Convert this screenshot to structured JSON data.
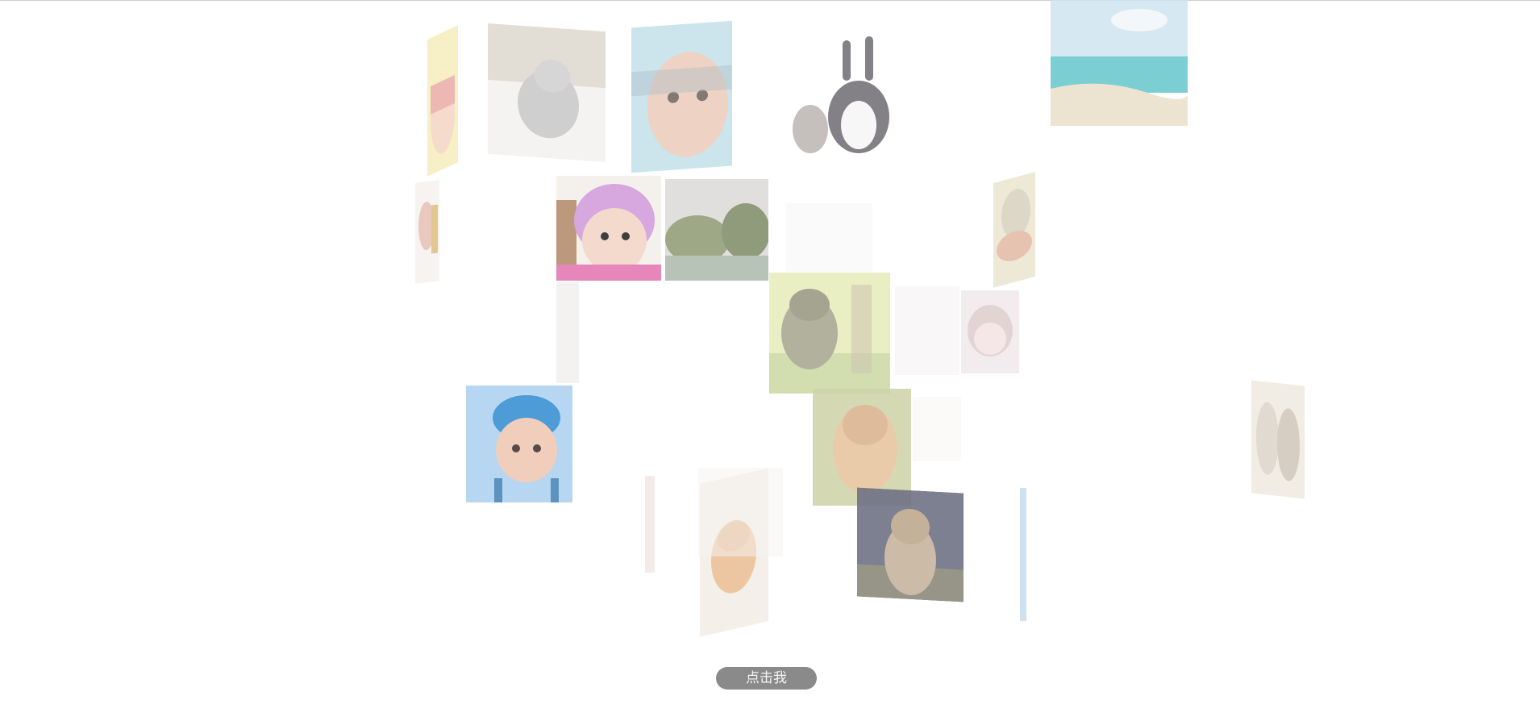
{
  "button": {
    "label": "点击我"
  },
  "gallery": {
    "tiles": [
      {
        "subject": "baby-hat",
        "palette": [
          "#f6ecb8",
          "#e9a7a0",
          "#f3d3bf"
        ]
      },
      {
        "subject": "kitten-grey",
        "palette": [
          "#d9d2c8",
          "#bfbfbf",
          "#f1efee"
        ]
      },
      {
        "subject": "baby-face",
        "palette": [
          "#bcdbe6",
          "#e9c4b0",
          "#8fa4b3"
        ]
      },
      {
        "subject": "cat-and-rabbit",
        "palette": [
          "#ffffff",
          "#6e6a72",
          "#bdb6b1"
        ]
      },
      {
        "subject": "beach",
        "palette": [
          "#cfe4f0",
          "#65c7cc",
          "#eadfc9"
        ]
      },
      {
        "subject": "baby-small",
        "palette": [
          "#f5f0ec",
          "#e2b7a7",
          "#d9b46d"
        ]
      },
      {
        "subject": "baby-pink-hat",
        "palette": [
          "#d39fdc",
          "#f2d6c8",
          "#e57ab3"
        ]
      },
      {
        "subject": "forest-painting",
        "palette": [
          "#d7d5d3",
          "#7e8a5e",
          "#9fb0a0"
        ]
      },
      {
        "subject": "baby-sleeping",
        "palette": [
          "#ece6cf",
          "#e2b9a3",
          "#d6d1bd"
        ]
      },
      {
        "subject": "cat-meadow",
        "palette": [
          "#e5ebb5",
          "#9e9e86",
          "#c7d79c"
        ]
      },
      {
        "subject": "baby-horn-hat",
        "palette": [
          "#efe4e8",
          "#d8c3c3",
          "#f2dede"
        ]
      },
      {
        "subject": "baby-blue-hat",
        "palette": [
          "#aad0ef",
          "#2e8ad1",
          "#efc6b0"
        ]
      },
      {
        "subject": "kitten-orange",
        "palette": [
          "#cdd3a8",
          "#e6c39b",
          "#d8b08a"
        ]
      },
      {
        "subject": "kitten-ginger",
        "palette": [
          "#f3ede6",
          "#e9bd91",
          "#e6e1dc"
        ]
      },
      {
        "subject": "kitten-praying",
        "palette": [
          "#707384",
          "#c7b49e",
          "#8c8a7c"
        ]
      },
      {
        "subject": "cat-pair",
        "palette": [
          "#ede6dc",
          "#d8cec2",
          "#c9bdaf"
        ]
      }
    ]
  }
}
